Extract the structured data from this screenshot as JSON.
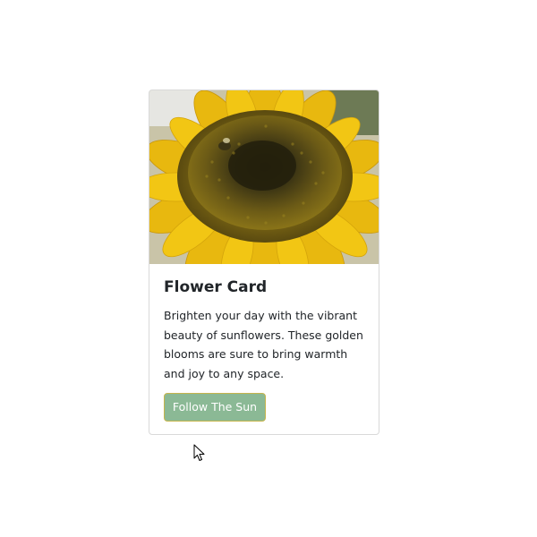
{
  "card": {
    "image_alt": "sunflower-photo",
    "title": "Flower Card",
    "text": "Brighten your day with the vibrant beauty of sunflowers. These golden blooms are sure to bring warmth and joy to any space.",
    "button_label": "Follow The Sun"
  },
  "colors": {
    "button_bg": "#8bb995",
    "button_border": "#c6b54c",
    "card_border": "#d9d9d9"
  }
}
